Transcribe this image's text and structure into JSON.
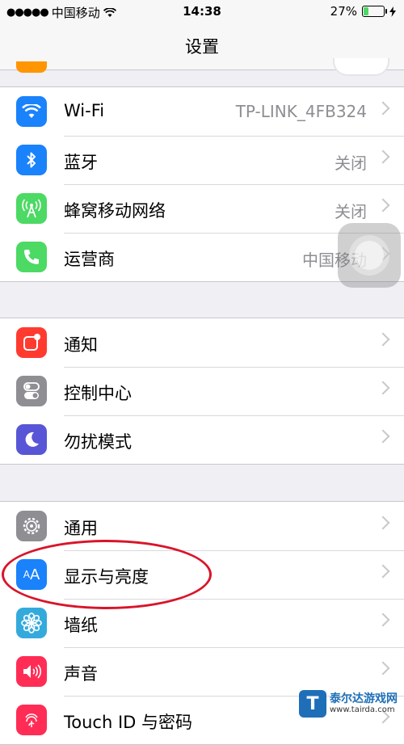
{
  "status_bar": {
    "signal": "●●●●●",
    "carrier": "中国移动",
    "time": "14:38",
    "battery_percent": "27%",
    "battery_level": 0.27
  },
  "nav": {
    "title": "设置"
  },
  "groups": [
    [
      {
        "label": "Wi-Fi",
        "value": "TP-LINK_4FB324",
        "icon": "wifi-icon",
        "color": "#1a82fb"
      },
      {
        "label": "蓝牙",
        "value": "关闭",
        "icon": "bluetooth-icon",
        "color": "#1a82fb"
      },
      {
        "label": "蜂窝移动网络",
        "value": "关闭",
        "icon": "cellular-icon",
        "color": "#4cd964"
      },
      {
        "label": "运营商",
        "value": "中国移动",
        "icon": "phone-icon",
        "color": "#4cd964"
      }
    ],
    [
      {
        "label": "通知",
        "value": "",
        "icon": "notification-icon",
        "color": "#ff3b30"
      },
      {
        "label": "控制中心",
        "value": "",
        "icon": "control-center-icon",
        "color": "#8e8e93"
      },
      {
        "label": "勿扰模式",
        "value": "",
        "icon": "moon-icon",
        "color": "#5856d6"
      }
    ],
    [
      {
        "label": "通用",
        "value": "",
        "icon": "gear-icon",
        "color": "#8e8e93"
      },
      {
        "label": "显示与亮度",
        "value": "",
        "icon": "display-brightness-icon",
        "color": "#1a82fb"
      },
      {
        "label": "墙纸",
        "value": "",
        "icon": "wallpaper-flower-icon",
        "color": "#34aadc"
      },
      {
        "label": "声音",
        "value": "",
        "icon": "speaker-icon",
        "color": "#ff2d55"
      },
      {
        "label": "Touch ID 与密码",
        "value": "",
        "icon": "fingerprint-icon",
        "color": "#ff2d55"
      }
    ]
  ],
  "watermark": {
    "name": "泰尔达游戏网",
    "url": "www.tairda.com",
    "logo_letter": "T"
  }
}
